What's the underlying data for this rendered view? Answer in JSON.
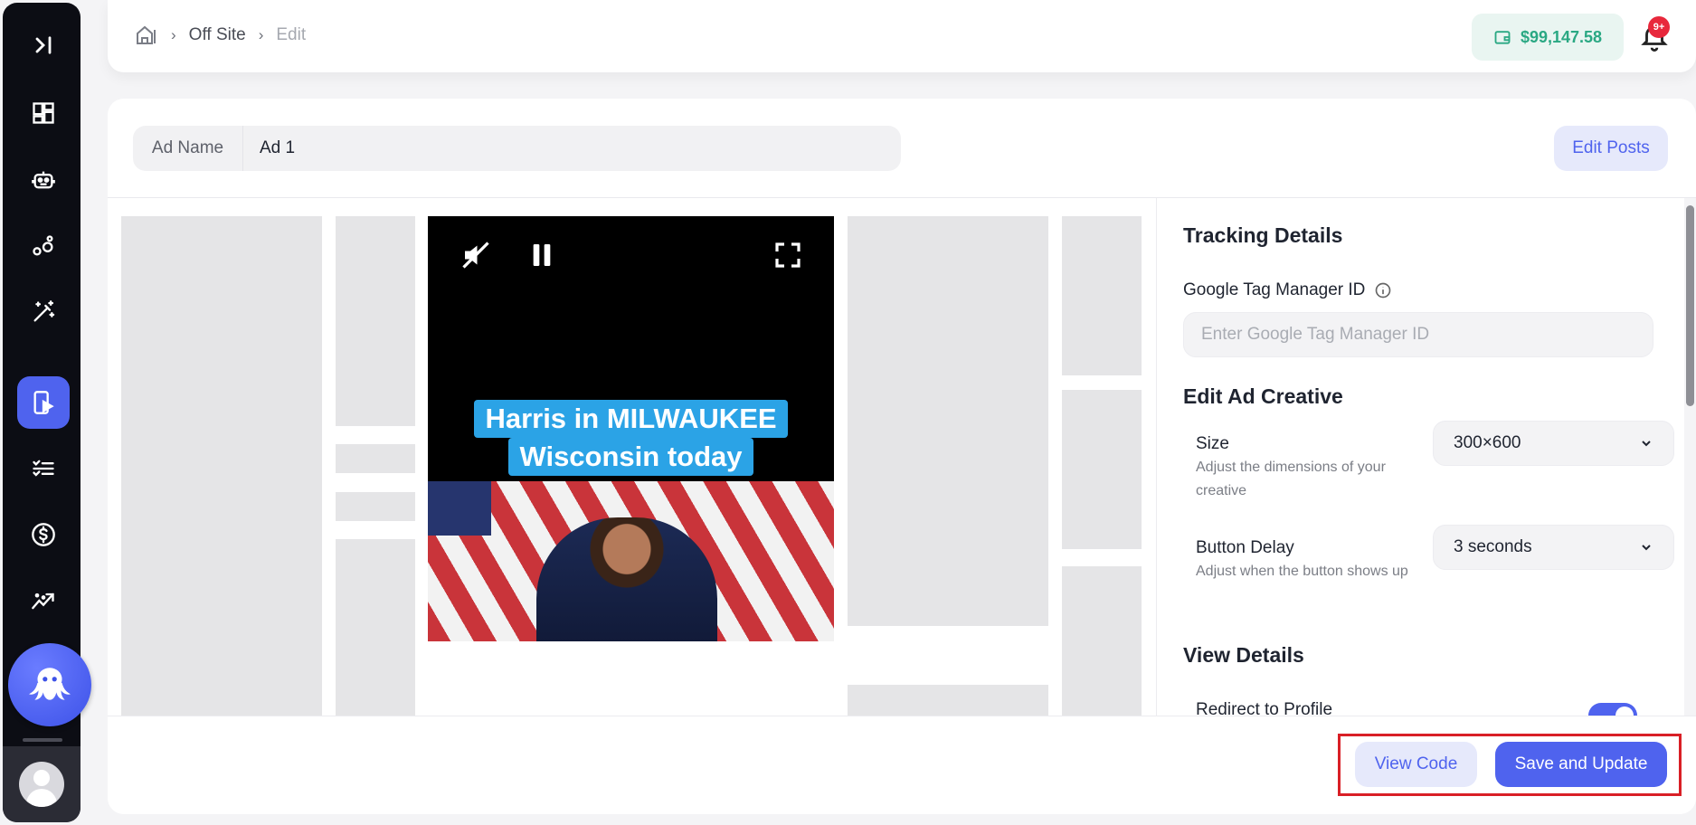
{
  "header": {
    "breadcrumb": [
      "Off Site",
      "Edit"
    ],
    "wallet_balance": "$99,147.58",
    "notification_badge": "9+"
  },
  "sidebar": {
    "toggle_icon": "expand-sidebar-icon",
    "items": [
      {
        "icon": "dashboard-icon",
        "active": false
      },
      {
        "icon": "robot-icon",
        "active": false
      },
      {
        "icon": "nodes-icon",
        "active": false
      },
      {
        "icon": "magic-wand-icon",
        "active": false
      },
      {
        "icon": "mobile-video-icon",
        "active": true
      },
      {
        "icon": "checklist-icon",
        "active": false
      },
      {
        "icon": "dollar-icon",
        "active": false
      },
      {
        "icon": "analytics-icon",
        "active": false
      }
    ]
  },
  "ad": {
    "name_label": "Ad Name",
    "name_value": "Ad 1",
    "edit_posts_label": "Edit Posts"
  },
  "video": {
    "caption_line1": "Harris in MILWAUKEE",
    "caption_line2": "Wisconsin today"
  },
  "tracking": {
    "title": "Tracking Details",
    "gtm_label": "Google Tag Manager ID",
    "gtm_placeholder": "Enter Google Tag Manager ID",
    "gtm_value": ""
  },
  "creative": {
    "title": "Edit Ad Creative",
    "size_label": "Size",
    "size_desc": "Adjust the dimensions of your creative",
    "size_value": "300×600",
    "delay_label": "Button Delay",
    "delay_desc": "Adjust when the button shows up",
    "delay_value": "3 seconds"
  },
  "view_details": {
    "title": "View Details",
    "redirect_label": "Redirect to Profile",
    "redirect_enabled": true
  },
  "footer": {
    "view_code_label": "View Code",
    "save_label": "Save and Update"
  },
  "colors": {
    "accent": "#4f63ee",
    "sidebar_bg": "#0c0d14",
    "wallet_green": "#2aa883",
    "highlight_red": "#d91f26"
  }
}
